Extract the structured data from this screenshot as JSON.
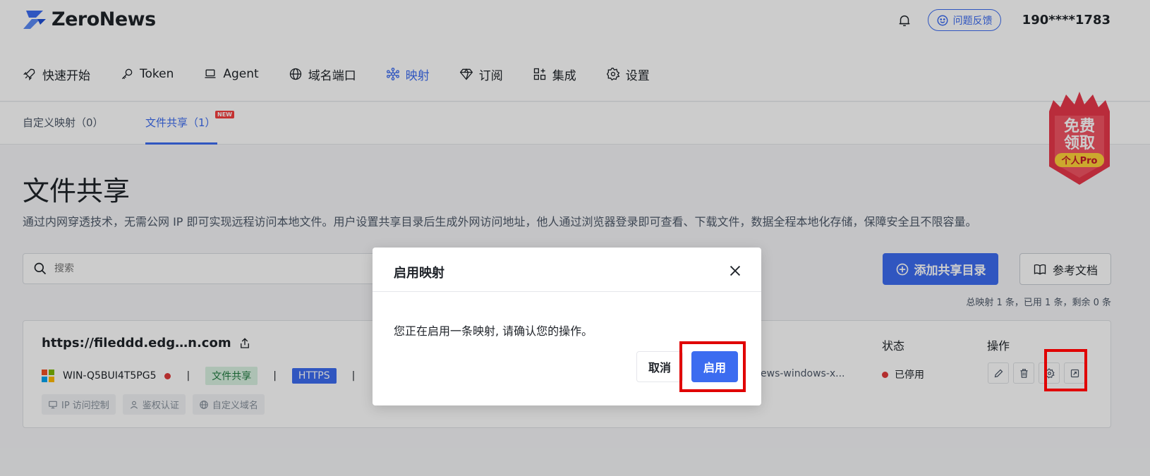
{
  "header": {
    "brand": "ZeroNews",
    "feedback_label": "问题反馈",
    "user_phone": "190****1783"
  },
  "nav": {
    "items": [
      {
        "label": "快速开始",
        "icon": "rocket-icon"
      },
      {
        "label": "Token",
        "icon": "key-icon"
      },
      {
        "label": "Agent",
        "icon": "laptop-icon"
      },
      {
        "label": "域名端口",
        "icon": "globe-icon"
      },
      {
        "label": "映射",
        "icon": "network-icon",
        "active": true
      },
      {
        "label": "订阅",
        "icon": "diamond-icon"
      },
      {
        "label": "集成",
        "icon": "apps-icon"
      },
      {
        "label": "设置",
        "icon": "gear-icon"
      }
    ]
  },
  "subtabs": {
    "custom": "自定义映射（0）",
    "fileshare": "文件共享（1）",
    "new_badge": "NEW"
  },
  "promo": {
    "line1": "免费",
    "line2": "领取",
    "line3": "个人Pro"
  },
  "page": {
    "title": "文件共享",
    "description": "通过内网穿透技术，无需公网 IP 即可实现远程访问本地文件。用户设置共享目录后生成外网访问地址，他人通过浏览器登录即可查看、下载文件，数据全程本地化存储，保障安全且不限容量。"
  },
  "toolbar": {
    "search_placeholder": "搜索",
    "add_label": "添加共享目录",
    "doc_label": "参考文档",
    "summary": "总映射 1 条，已用 1 条，剩余 0 条"
  },
  "card": {
    "url": "https://fileddd.edg…n.com",
    "agent_name": "WIN-Q5BUI4T5PG5",
    "tag_type": "文件共享",
    "tag_protocol": "HTTPS",
    "path": "ews-windows-x...",
    "status_header": "状态",
    "ops_header": "操作",
    "status": "已停用",
    "chips": [
      "IP 访问控制",
      "鉴权认证",
      "自定义域名"
    ]
  },
  "modal": {
    "title": "启用映射",
    "message": "您正在启用一条映射, 请确认您的操作。",
    "cancel_label": "取消",
    "confirm_label": "启用"
  },
  "colors": {
    "accent": "#3c6cf0",
    "danger": "#e03a3a",
    "highlight": "#e00000"
  }
}
